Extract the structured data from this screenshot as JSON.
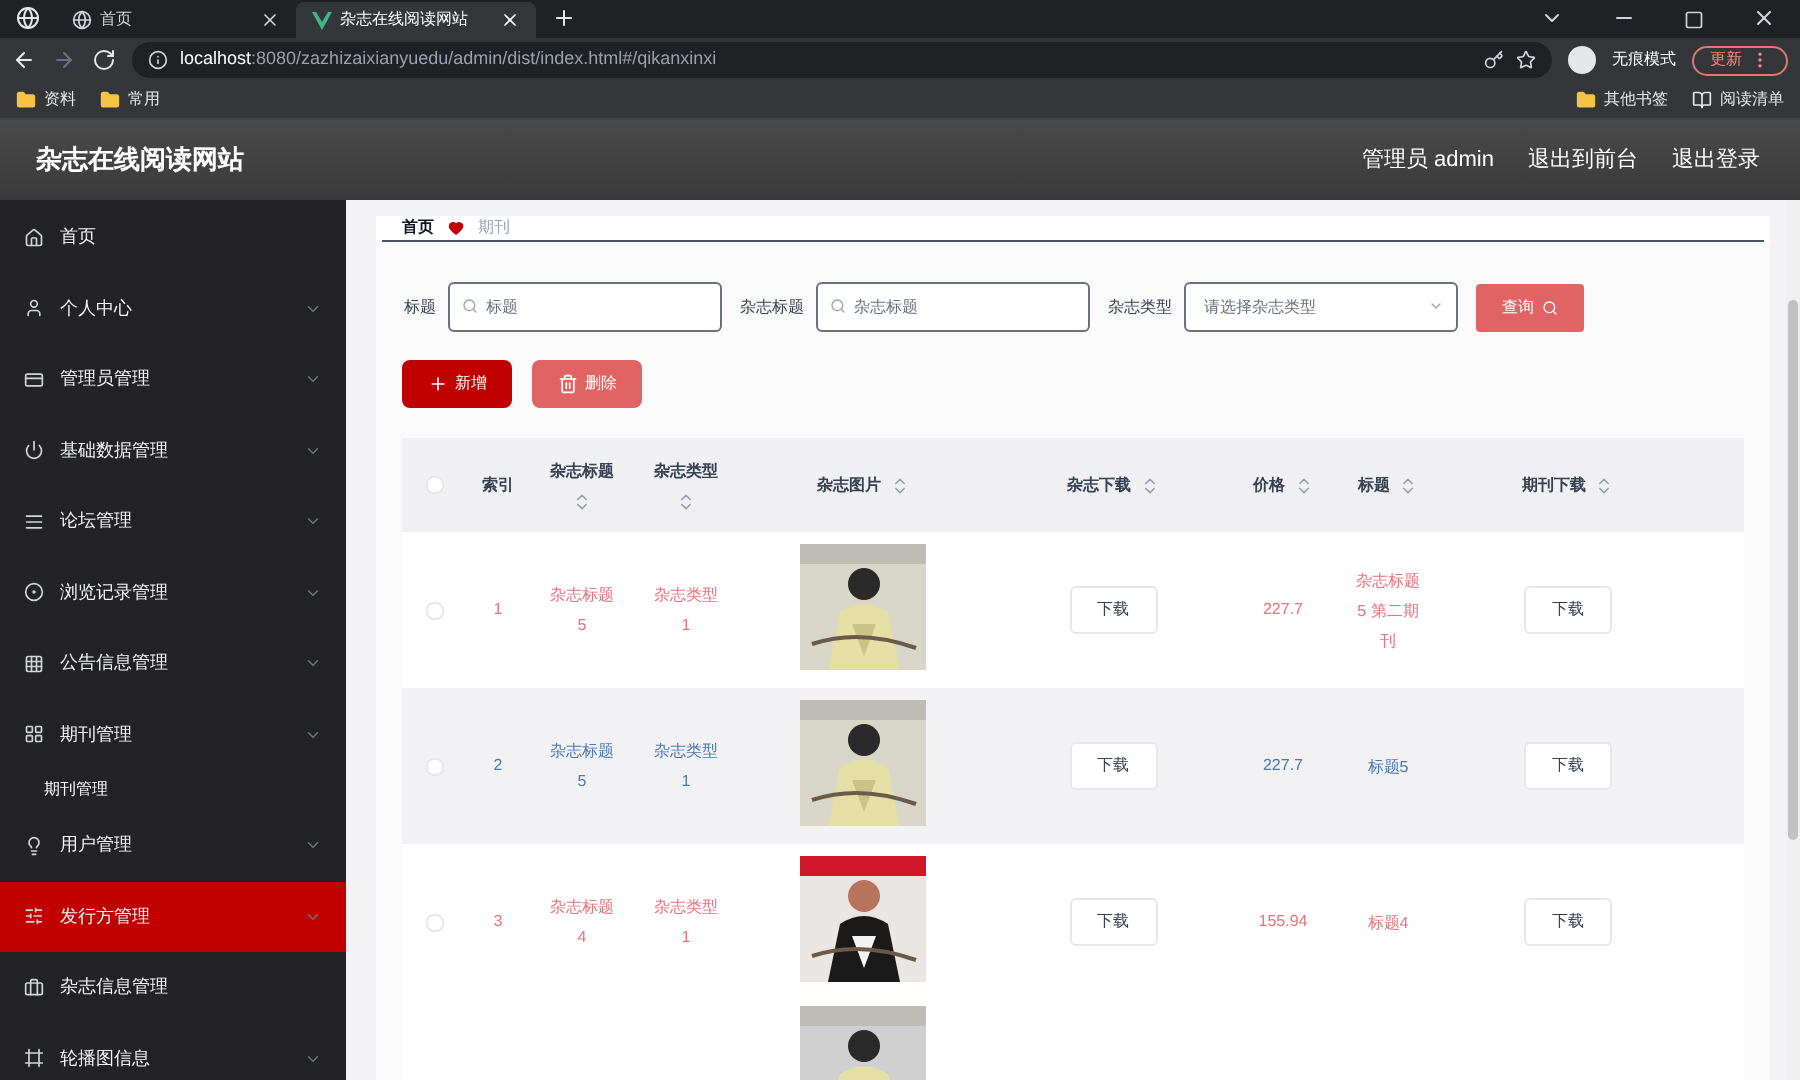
{
  "browser": {
    "tabs": [
      {
        "title": "首页",
        "selected": false
      },
      {
        "title": "杂志在线阅读网站",
        "selected": true
      }
    ],
    "url_host": "localhost",
    "url_rest": ":8080/zazhizaixianyuedu/admin/dist/index.html#/qikanxinxi",
    "incognito": "无痕模式",
    "update": "更新",
    "bookmarks": [
      "资料",
      "常用"
    ],
    "bookmarks_right": [
      "其他书签",
      "阅读清单"
    ]
  },
  "header": {
    "title": "杂志在线阅读网站",
    "links": [
      "管理员 admin",
      "退出到前台",
      "退出登录"
    ]
  },
  "sidebar": {
    "items": [
      {
        "label": "首页",
        "expandable": false,
        "selected": false
      },
      {
        "label": "个人中心",
        "expandable": true,
        "selected": false
      },
      {
        "label": "管理员管理",
        "expandable": true,
        "selected": false
      },
      {
        "label": "基础数据管理",
        "expandable": true,
        "selected": false
      },
      {
        "label": "论坛管理",
        "expandable": true,
        "selected": false
      },
      {
        "label": "浏览记录管理",
        "expandable": true,
        "selected": false
      },
      {
        "label": "公告信息管理",
        "expandable": true,
        "selected": false
      },
      {
        "label": "期刊管理",
        "expandable": true,
        "selected": false,
        "children": [
          {
            "label": "期刊管理"
          }
        ]
      },
      {
        "label": "用户管理",
        "expandable": true,
        "selected": false
      },
      {
        "label": "发行方管理",
        "expandable": true,
        "selected": true
      },
      {
        "label": "杂志信息管理",
        "expandable": false,
        "selected": false
      },
      {
        "label": "轮播图信息",
        "expandable": true,
        "selected": false
      }
    ]
  },
  "breadcrumb": [
    "首页",
    "期刊"
  ],
  "filters": [
    {
      "label": "标题",
      "placeholder": "标题",
      "kind": "search"
    },
    {
      "label": "杂志标题",
      "placeholder": "杂志标题",
      "kind": "search"
    },
    {
      "label": "杂志类型",
      "placeholder": "请选择杂志类型",
      "kind": "select"
    }
  ],
  "query_button": "查询",
  "actions": [
    "新增",
    "删除"
  ],
  "table": {
    "all_checked": false,
    "columns": [
      "索引",
      "杂志标题",
      "杂志类型",
      "杂志图片",
      "杂志下载",
      "价格",
      "标题",
      "期刊下载"
    ],
    "rows": [
      {
        "kind": "record",
        "checked": false,
        "index": "1",
        "title": "杂志标题5",
        "type": "杂志类型1",
        "download": "下载",
        "price": "227.7",
        "heading": "杂志标题5 第二期刊",
        "issue_download": "下载",
        "color": "#e8737a",
        "selected": false
      },
      {
        "kind": "record",
        "checked": false,
        "index": "2",
        "title": "杂志标题5",
        "type": "杂志类型1",
        "download": "下载",
        "price": "227.7",
        "heading": "标题5",
        "issue_download": "下载",
        "color": "#4a78b5",
        "selected": true
      },
      {
        "kind": "record",
        "checked": false,
        "index": "3",
        "title": "杂志标题4",
        "type": "杂志类型1",
        "download": "下载",
        "price": "155.94",
        "heading": "标题4",
        "issue_download": "下载",
        "color": "#e8737a",
        "selected": false
      },
      {
        "kind": "picture",
        "selected": false
      }
    ]
  }
}
